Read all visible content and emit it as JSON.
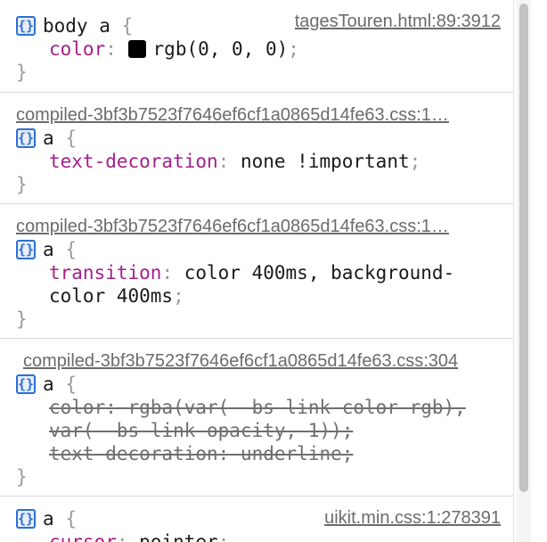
{
  "rules": [
    {
      "source": "tagesTouren.html:89:3912",
      "selector": "body a",
      "decls": [
        {
          "prop": "color",
          "value": "rgb(0, 0, 0)"
        }
      ]
    },
    {
      "source": "compiled-3bf3b7523f7646ef6cf1a0865d14fe63.css:1…",
      "selector": "a",
      "decls": [
        {
          "prop": "text-decoration",
          "value": "none !important"
        }
      ]
    },
    {
      "source": "compiled-3bf3b7523f7646ef6cf1a0865d14fe63.css:1…",
      "selector": "a",
      "decls": [
        {
          "prop": "transition",
          "value1": "color 400ms, background-",
          "value2": "color 400ms"
        }
      ]
    },
    {
      "source": "compiled-3bf3b7523f7646ef6cf1a0865d14fe63.css:304",
      "selector": "a",
      "decls": [
        {
          "prop": "color",
          "value1": "rgba(var(--bs-link-color-rgb),",
          "value2": "var(--bs-link-opacity, 1))"
        },
        {
          "prop": "text-decoration",
          "value": "underline"
        }
      ]
    },
    {
      "source": "uikit.min.css:1:278391",
      "selector": "a",
      "decls": [
        {
          "prop": "cursor",
          "value": "pointer"
        }
      ]
    }
  ],
  "glyphs": {
    "open_brace": "{",
    "close_brace": "}",
    "colon": ":",
    "semicolon": ";",
    "badge": "{}"
  },
  "colors": {
    "property": "#a61e8a",
    "badge": "#2d6fd6",
    "swatch": "#000000"
  }
}
